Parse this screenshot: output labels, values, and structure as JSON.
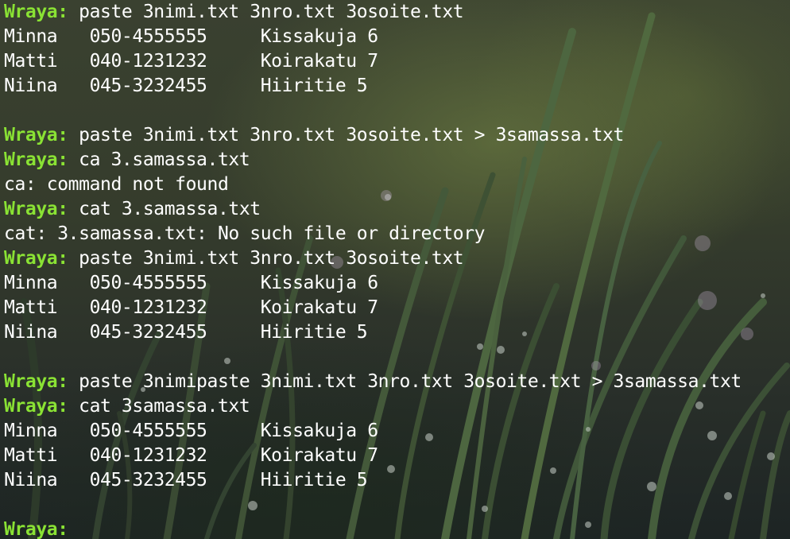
{
  "terminal": {
    "prompt": "Wraya:",
    "lines": [
      {
        "type": "prompt",
        "command": " paste 3nimi.txt 3nro.txt 3osoite.txt"
      },
      {
        "type": "output",
        "text": "Minna   050-4555555     Kissakuja 6"
      },
      {
        "type": "output",
        "text": "Matti   040-1231232     Koirakatu 7"
      },
      {
        "type": "output",
        "text": "Niina   045-3232455     Hiiritie 5"
      },
      {
        "type": "blank",
        "text": ""
      },
      {
        "type": "prompt",
        "command": " paste 3nimi.txt 3nro.txt 3osoite.txt > 3samassa.txt"
      },
      {
        "type": "prompt",
        "command": " ca 3.samassa.txt"
      },
      {
        "type": "output",
        "text": "ca: command not found"
      },
      {
        "type": "prompt",
        "command": " cat 3.samassa.txt"
      },
      {
        "type": "output",
        "text": "cat: 3.samassa.txt: No such file or directory"
      },
      {
        "type": "prompt",
        "command": " paste 3nimi.txt 3nro.txt 3osoite.txt"
      },
      {
        "type": "output",
        "text": "Minna   050-4555555     Kissakuja 6"
      },
      {
        "type": "output",
        "text": "Matti   040-1231232     Koirakatu 7"
      },
      {
        "type": "output",
        "text": "Niina   045-3232455     Hiiritie 5"
      },
      {
        "type": "blank",
        "text": ""
      },
      {
        "type": "prompt",
        "command": " paste 3nimipaste 3nimi.txt 3nro.txt 3osoite.txt > 3samassa.txt"
      },
      {
        "type": "prompt",
        "command": " cat 3samassa.txt"
      },
      {
        "type": "output",
        "text": "Minna   050-4555555     Kissakuja 6"
      },
      {
        "type": "output",
        "text": "Matti   040-1231232     Koirakatu 7"
      },
      {
        "type": "output",
        "text": "Niina   045-3232455     Hiiritie 5"
      },
      {
        "type": "blank",
        "text": ""
      },
      {
        "type": "prompt",
        "command": ""
      }
    ]
  },
  "colors": {
    "prompt": "#8ae234",
    "text": "#ffffff"
  },
  "background": {
    "icon": "grass-wallpaper"
  }
}
